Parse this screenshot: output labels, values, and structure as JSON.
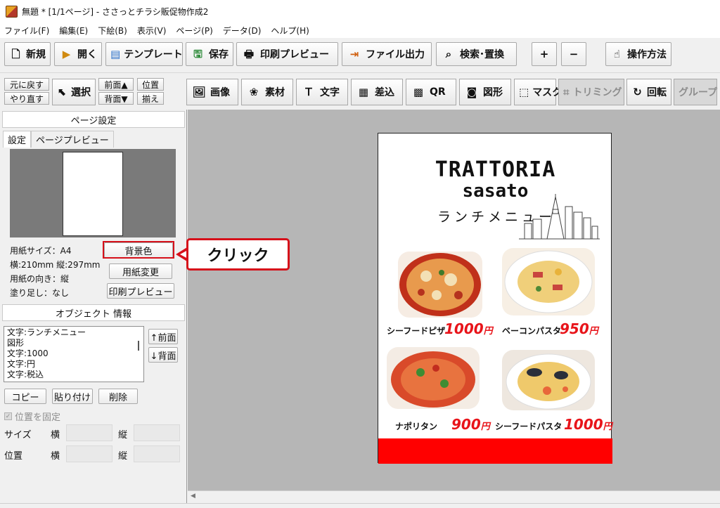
{
  "titlebar": {
    "title": "無題 * [1/1ページ] - ささっとチラシ販促物作成2"
  },
  "menu": [
    "ファイル(F)",
    "編集(E)",
    "下絵(B)",
    "表示(V)",
    "ページ(P)",
    "データ(D)",
    "ヘルプ(H)"
  ],
  "toolbar_main": {
    "new": "新規",
    "open": "開く",
    "template": "テンプレート",
    "save": "保存",
    "print_preview": "印刷プレビュー",
    "file_output": "ファイル出力",
    "search_replace": "検索･置換",
    "zoom_in": "+",
    "zoom_out": "−",
    "how_to": "操作方法"
  },
  "toolbar_objects": {
    "undo": "元に戻す",
    "redo": "やり直す",
    "select": "選択",
    "front": "前面▲",
    "back": "背面▼",
    "align_1": "位置",
    "align_2": "揃え",
    "image": "画像",
    "material": "素材",
    "text": "文字",
    "merge": "差込",
    "qr": "QR",
    "shape": "図形",
    "mask": "マスク",
    "trimming": "トリミング",
    "rotate": "回転",
    "group": "グループ"
  },
  "page_settings": {
    "header": "ページ設定",
    "tab_settings": "設定",
    "tab_preview": "ページプレビュー",
    "paper_size": "用紙サイズ：A4",
    "dimensions": "横:210mm 縦:297mm",
    "orientation": "用紙の向き：縦",
    "bleed": "塗り足し：なし",
    "btn_bg_color": "背景色",
    "btn_change_paper": "用紙変更",
    "btn_print_preview": "印刷プレビュー"
  },
  "object_info": {
    "header": "オブジェクト 情報",
    "items": [
      "文字:ランチメニュー",
      "図形",
      "文字:1000",
      "文字:円",
      "文字:税込"
    ],
    "btn_front": "↑前面",
    "btn_back": "↓背面",
    "btn_copy": "コピー",
    "btn_paste": "貼り付け",
    "btn_delete": "削除",
    "lock_position": "位置を固定",
    "size_label": "サイズ",
    "pos_label": "位置",
    "width_label": "横",
    "height_label": "縦"
  },
  "callout": {
    "text": "クリック"
  },
  "flyer": {
    "title_line1": "TRATTORIA",
    "title_line2": "sasato",
    "subtitle": "ランチメニュー",
    "dishes": [
      {
        "name": "シーフードピザ",
        "price": "1000",
        "unit": "円"
      },
      {
        "name": "ベーコンパスタ",
        "price": "950",
        "unit": "円"
      },
      {
        "name": "ナポリタン",
        "price": "900",
        "unit": "円"
      },
      {
        "name": "シーフードパスタ",
        "price": "1000",
        "unit": "円"
      }
    ]
  },
  "colors": {
    "price_red": "#e8141a",
    "band_red": "#ff0000",
    "callout_border": "#d6101a"
  }
}
